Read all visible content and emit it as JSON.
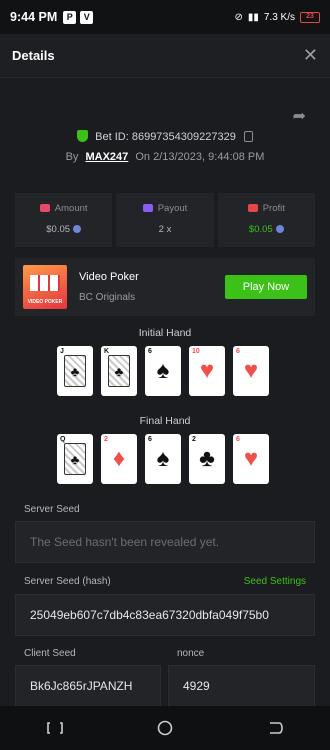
{
  "status_bar": {
    "time": "9:44 PM",
    "net_speed": "7.3 K/s",
    "battery": "23"
  },
  "header": {
    "title": "Details",
    "close_glyph": "✕"
  },
  "bet": {
    "id_label": "Bet ID: 86997354309227329",
    "by_prefix": "By",
    "user": "MAX247",
    "on_prefix": "On",
    "date": "2/13/2023, 9:44:08 PM"
  },
  "stats": {
    "amount": {
      "label": "Amount",
      "value": "$0.05"
    },
    "payout": {
      "label": "Payout",
      "value": "2 x"
    },
    "profit": {
      "label": "Profit",
      "value": "$0.05"
    }
  },
  "game": {
    "name": "Video Poker",
    "provider": "BC Originals",
    "thumb_text": "VIDEO POKER",
    "play_label": "Play Now"
  },
  "initial_hand": {
    "label": "Initial Hand",
    "cards": [
      {
        "rank": "J",
        "suit": "♣",
        "color": "blk",
        "face": true
      },
      {
        "rank": "K",
        "suit": "♣",
        "color": "blk",
        "face": true
      },
      {
        "rank": "6",
        "suit": "♠",
        "color": "blk",
        "face": false
      },
      {
        "rank": "10",
        "suit": "♥",
        "color": "red",
        "face": false
      },
      {
        "rank": "6",
        "suit": "♥",
        "color": "red",
        "face": false
      }
    ]
  },
  "final_hand": {
    "label": "Final Hand",
    "cards": [
      {
        "rank": "Q",
        "suit": "♣",
        "color": "blk",
        "face": true
      },
      {
        "rank": "2",
        "suit": "♦",
        "color": "red",
        "face": false
      },
      {
        "rank": "6",
        "suit": "♠",
        "color": "blk",
        "face": false
      },
      {
        "rank": "2",
        "suit": "♣",
        "color": "blk",
        "face": false
      },
      {
        "rank": "6",
        "suit": "♥",
        "color": "red",
        "face": false
      }
    ]
  },
  "seeds": {
    "server_seed_label": "Server Seed",
    "server_seed_value": "The Seed hasn't been revealed yet.",
    "server_hash_label": "Server Seed (hash)",
    "seed_settings_label": "Seed Settings",
    "server_hash_value": "25049eb607c7db4c83ea67320dbfa049f75b0",
    "client_seed_label": "Client Seed",
    "client_seed_value": "Bk6Jc865rJPANZH",
    "nonce_label": "nonce",
    "nonce_value": "4929"
  },
  "colors": {
    "accent": "#3bc117",
    "panel": "#232428",
    "background": "#1b1c1f"
  }
}
